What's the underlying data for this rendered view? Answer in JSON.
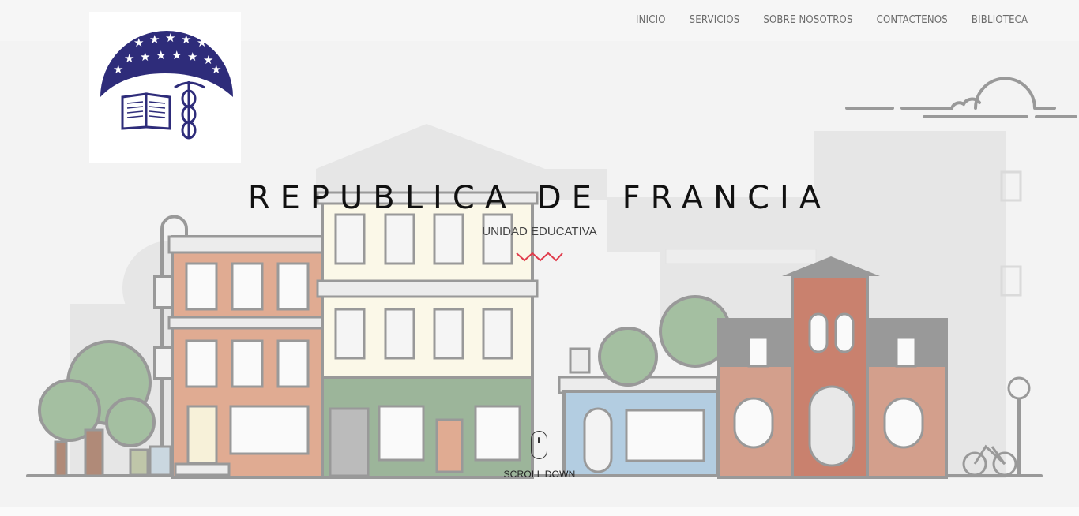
{
  "nav": {
    "items": [
      {
        "label": "INICIO"
      },
      {
        "label": "SERVICIOS"
      },
      {
        "label": "SOBRE NOSOTROS"
      },
      {
        "label": "CONTACTENOS"
      },
      {
        "label": "BIBLIOTECA"
      }
    ]
  },
  "hero": {
    "title": "REPUBLICA DE FRANCIA",
    "subtitle": "UNIDAD EDUCATIVA",
    "scroll_label": "SCROLL DOWN"
  },
  "colors": {
    "logo_navy": "#2e2c7a",
    "zigzag": "#e03b4b",
    "outline": "#8d8d8d"
  },
  "icons": [
    "logo-emblem",
    "zigzag-divider-icon",
    "mouse-scroll-icon"
  ]
}
